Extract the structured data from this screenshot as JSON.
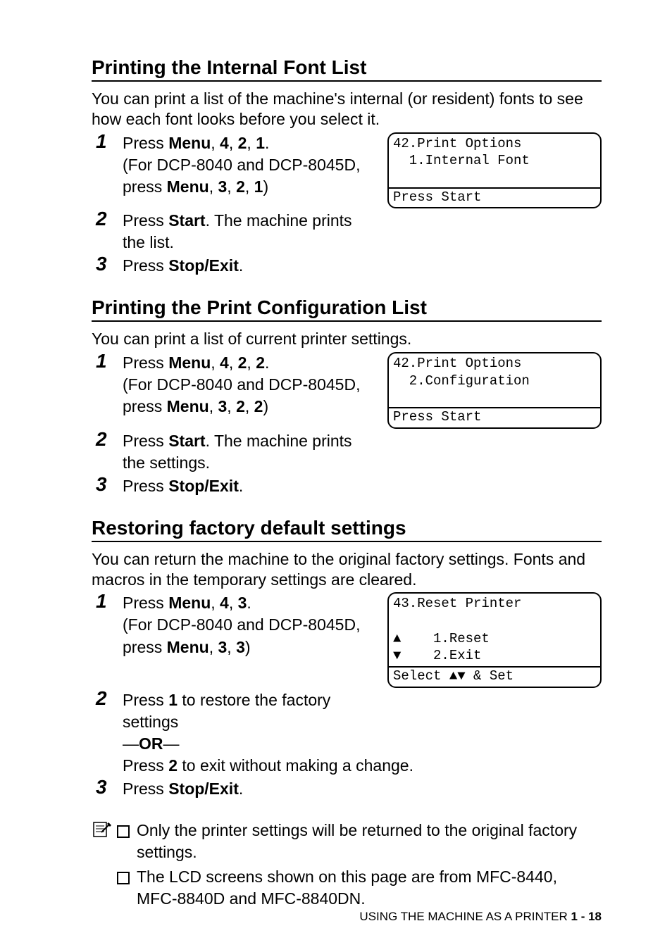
{
  "sections": [
    {
      "title": "Printing the Internal Font List",
      "intro": "You can print a list of the machine's internal (or resident) fonts to see how each font looks before you select it.",
      "lcd": {
        "top": "42.Print Options\n  1.Internal Font",
        "bot": "Press Start"
      },
      "steps": {
        "s1": {
          "pre": "Press ",
          "kw0": "Menu",
          "seq": ", ",
          "k1": "4",
          "k2": "2",
          "k3": "1",
          "dot": ".",
          "paren0": "(For DCP-8040 and DCP-8045D, press ",
          "pkw": "Menu",
          "pk1": "3",
          "pk2": "2",
          "pk3": "1",
          "paren1": ")"
        },
        "s2": {
          "pre": "Press ",
          "kw": "Start",
          "rest": ". The machine prints the list."
        },
        "s3": {
          "pre": "Press ",
          "kw": "Stop/Exit",
          "rest": "."
        }
      }
    },
    {
      "title": "Printing the Print Configuration List",
      "intro": "You can print a list of current printer settings.",
      "lcd": {
        "top": "42.Print Options\n  2.Configuration",
        "bot": "Press Start"
      },
      "steps": {
        "s1": {
          "pre": "Press ",
          "kw0": "Menu",
          "seq": ", ",
          "k1": "4",
          "k2": "2",
          "k3": "2",
          "dot": ".",
          "paren0": "(For DCP-8040 and DCP-8045D, press ",
          "pkw": "Menu",
          "pk1": "3",
          "pk2": "2",
          "pk3": "2",
          "paren1": ")"
        },
        "s2": {
          "pre": "Press ",
          "kw": "Start",
          "rest": ". The machine prints the settings."
        },
        "s3": {
          "pre": "Press ",
          "kw": "Stop/Exit",
          "rest": "."
        }
      }
    },
    {
      "title": "Restoring factory default settings",
      "intro": "You can return the machine to the original factory settings. Fonts and macros in the temporary settings are cleared.",
      "lcd": {
        "top": "43.Reset Printer\n\n▲    1.Reset\n▼    2.Exit",
        "bot": "Select ▲▼ & Set"
      },
      "steps": {
        "s1": {
          "pre": "Press ",
          "kw0": "Menu",
          "seq": ", ",
          "k1": "4",
          "k2": "3",
          "dot": ".",
          "paren0": "(For DCP-8040 and DCP-8045D, press ",
          "pkw": "Menu",
          "pk1": "3",
          "pk2": "3",
          "paren1": ")"
        },
        "s2": {
          "pre": "Press ",
          "kw": "1",
          "rest": " to restore the factory settings",
          "or": "—OR—",
          "pre2": "Press ",
          "kw2": "2",
          "rest2": " to exit without making a change."
        },
        "s3": {
          "pre": "Press ",
          "kw": "Stop/Exit",
          "rest": "."
        }
      },
      "notes": [
        "Only the printer settings will be returned to the original factory settings.",
        "The LCD screens shown on this page are from MFC-8440, MFC-8840D and MFC-8840DN."
      ]
    }
  ],
  "footer": {
    "text": "USING THE MACHINE AS A PRINTER   ",
    "page": "1 - 18"
  }
}
